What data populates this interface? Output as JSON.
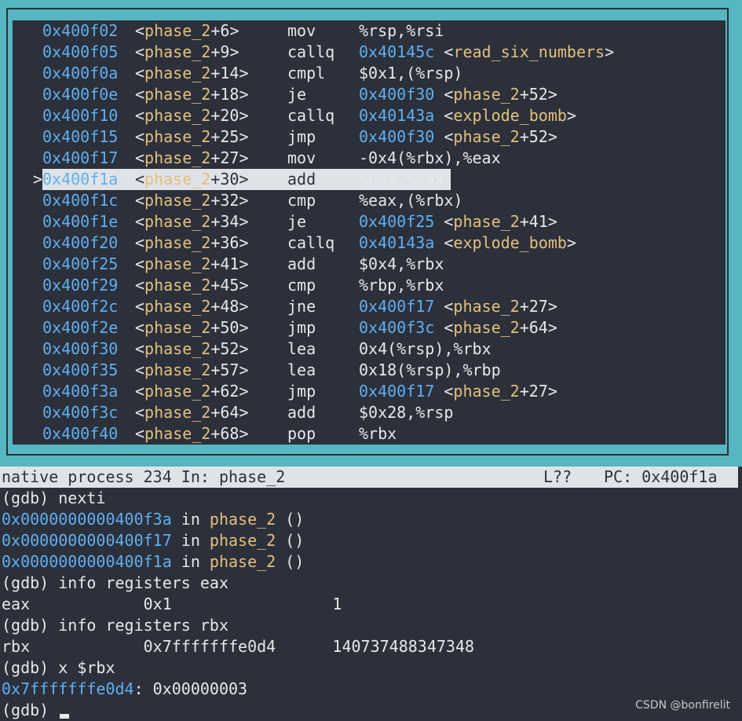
{
  "asm_rows": [
    {
      "addr": "0x400f02",
      "fn": "phase_2",
      "off": "+6",
      "mn": "mov",
      "ops": [
        {
          "t": "%rsp,%rsi",
          "c": "w"
        }
      ]
    },
    {
      "addr": "0x400f05",
      "fn": "phase_2",
      "off": "+9",
      "mn": "callq",
      "ops": [
        {
          "t": "0x40145c",
          "c": "b"
        },
        {
          "t": " <",
          "c": "w"
        },
        {
          "t": "read_six_numbers",
          "c": "y"
        },
        {
          "t": ">",
          "c": "w"
        }
      ]
    },
    {
      "addr": "0x400f0a",
      "fn": "phase_2",
      "off": "+14",
      "mn": "cmpl",
      "ops": [
        {
          "t": "$0x1,(%rsp)",
          "c": "w"
        }
      ]
    },
    {
      "addr": "0x400f0e",
      "fn": "phase_2",
      "off": "+18",
      "mn": "je",
      "ops": [
        {
          "t": "0x400f30",
          "c": "b"
        },
        {
          "t": " <",
          "c": "w"
        },
        {
          "t": "phase_2",
          "c": "y"
        },
        {
          "t": "+52>",
          "c": "w"
        }
      ]
    },
    {
      "addr": "0x400f10",
      "fn": "phase_2",
      "off": "+20",
      "mn": "callq",
      "ops": [
        {
          "t": "0x40143a",
          "c": "b"
        },
        {
          "t": " <",
          "c": "w"
        },
        {
          "t": "explode_bomb",
          "c": "y"
        },
        {
          "t": ">",
          "c": "w"
        }
      ]
    },
    {
      "addr": "0x400f15",
      "fn": "phase_2",
      "off": "+25",
      "mn": "jmp",
      "ops": [
        {
          "t": "0x400f30",
          "c": "b"
        },
        {
          "t": " <",
          "c": "w"
        },
        {
          "t": "phase_2",
          "c": "y"
        },
        {
          "t": "+52>",
          "c": "w"
        }
      ]
    },
    {
      "addr": "0x400f17",
      "fn": "phase_2",
      "off": "+27",
      "mn": "mov",
      "ops": [
        {
          "t": "-0x4(%rbx),%eax",
          "c": "w"
        }
      ]
    },
    {
      "addr": "0x400f1a",
      "fn": "phase_2",
      "off": "+30",
      "mn": "add",
      "ops": [
        {
          "t": "%eax,%eax",
          "c": "w"
        }
      ],
      "current": true
    },
    {
      "addr": "0x400f1c",
      "fn": "phase_2",
      "off": "+32",
      "mn": "cmp",
      "ops": [
        {
          "t": "%eax,(%rbx)",
          "c": "w"
        }
      ]
    },
    {
      "addr": "0x400f1e",
      "fn": "phase_2",
      "off": "+34",
      "mn": "je",
      "ops": [
        {
          "t": "0x400f25",
          "c": "b"
        },
        {
          "t": " <",
          "c": "w"
        },
        {
          "t": "phase_2",
          "c": "y"
        },
        {
          "t": "+41>",
          "c": "w"
        }
      ]
    },
    {
      "addr": "0x400f20",
      "fn": "phase_2",
      "off": "+36",
      "mn": "callq",
      "ops": [
        {
          "t": "0x40143a",
          "c": "b"
        },
        {
          "t": " <",
          "c": "w"
        },
        {
          "t": "explode_bomb",
          "c": "y"
        },
        {
          "t": ">",
          "c": "w"
        }
      ]
    },
    {
      "addr": "0x400f25",
      "fn": "phase_2",
      "off": "+41",
      "mn": "add",
      "ops": [
        {
          "t": "$0x4,%rbx",
          "c": "w"
        }
      ]
    },
    {
      "addr": "0x400f29",
      "fn": "phase_2",
      "off": "+45",
      "mn": "cmp",
      "ops": [
        {
          "t": "%rbp,%rbx",
          "c": "w"
        }
      ]
    },
    {
      "addr": "0x400f2c",
      "fn": "phase_2",
      "off": "+48",
      "mn": "jne",
      "ops": [
        {
          "t": "0x400f17",
          "c": "b"
        },
        {
          "t": " <",
          "c": "w"
        },
        {
          "t": "phase_2",
          "c": "y"
        },
        {
          "t": "+27>",
          "c": "w"
        }
      ]
    },
    {
      "addr": "0x400f2e",
      "fn": "phase_2",
      "off": "+50",
      "mn": "jmp",
      "ops": [
        {
          "t": "0x400f3c",
          "c": "b"
        },
        {
          "t": " <",
          "c": "w"
        },
        {
          "t": "phase_2",
          "c": "y"
        },
        {
          "t": "+64>",
          "c": "w"
        }
      ]
    },
    {
      "addr": "0x400f30",
      "fn": "phase_2",
      "off": "+52",
      "mn": "lea",
      "ops": [
        {
          "t": "0x4(%rsp),%rbx",
          "c": "w"
        }
      ]
    },
    {
      "addr": "0x400f35",
      "fn": "phase_2",
      "off": "+57",
      "mn": "lea",
      "ops": [
        {
          "t": "0x18(%rsp),%rbp",
          "c": "w"
        }
      ]
    },
    {
      "addr": "0x400f3a",
      "fn": "phase_2",
      "off": "+62",
      "mn": "jmp",
      "ops": [
        {
          "t": "0x400f17",
          "c": "b"
        },
        {
          "t": " <",
          "c": "w"
        },
        {
          "t": "phase_2",
          "c": "y"
        },
        {
          "t": "+27>",
          "c": "w"
        }
      ]
    },
    {
      "addr": "0x400f3c",
      "fn": "phase_2",
      "off": "+64",
      "mn": "add",
      "ops": [
        {
          "t": "$0x28,%rsp",
          "c": "w"
        }
      ]
    },
    {
      "addr": "0x400f40",
      "fn": "phase_2",
      "off": "+68",
      "mn": "pop",
      "ops": [
        {
          "t": "%rbx",
          "c": "w"
        }
      ]
    }
  ],
  "current_marker": ">",
  "status": {
    "process": "native process 234 In: phase_2",
    "line": "L??",
    "pc": "PC: 0x400f1a"
  },
  "terminal_lines": [
    [
      {
        "t": "(gdb) nexti",
        "c": "w"
      }
    ],
    [
      {
        "t": "0x0000000000400f3a",
        "c": "b"
      },
      {
        "t": " in ",
        "c": "w"
      },
      {
        "t": "phase_2",
        "c": "y"
      },
      {
        "t": " ()",
        "c": "w"
      }
    ],
    [
      {
        "t": "0x0000000000400f17",
        "c": "b"
      },
      {
        "t": " in ",
        "c": "w"
      },
      {
        "t": "phase_2",
        "c": "y"
      },
      {
        "t": " ()",
        "c": "w"
      }
    ],
    [
      {
        "t": "0x0000000000400f1a",
        "c": "b"
      },
      {
        "t": " in ",
        "c": "w"
      },
      {
        "t": "phase_2",
        "c": "y"
      },
      {
        "t": " ()",
        "c": "w"
      }
    ],
    [
      {
        "t": "(gdb) info registers eax",
        "c": "w"
      }
    ],
    [
      {
        "t": "eax            0x1                 1",
        "c": "w"
      }
    ],
    [
      {
        "t": "(gdb) info registers rbx",
        "c": "w"
      }
    ],
    [
      {
        "t": "rbx            0x7fffffffe0d4      140737488347348",
        "c": "w"
      }
    ],
    [
      {
        "t": "(gdb) x $rbx",
        "c": "w"
      }
    ],
    [
      {
        "t": "0x7fffffffe0d4",
        "c": "b"
      },
      {
        "t": ": 0x00000003",
        "c": "w"
      }
    ],
    [
      {
        "t": "(gdb) ",
        "c": "w"
      }
    ]
  ],
  "watermark": "CSDN @bonfirelit",
  "colors": {
    "bg": "#2b303b",
    "frame": "#56b6c2",
    "addr": "#61afef",
    "sym": "#e5c07b",
    "text": "#e8e8e8",
    "highlight": "#dfe3e8"
  }
}
